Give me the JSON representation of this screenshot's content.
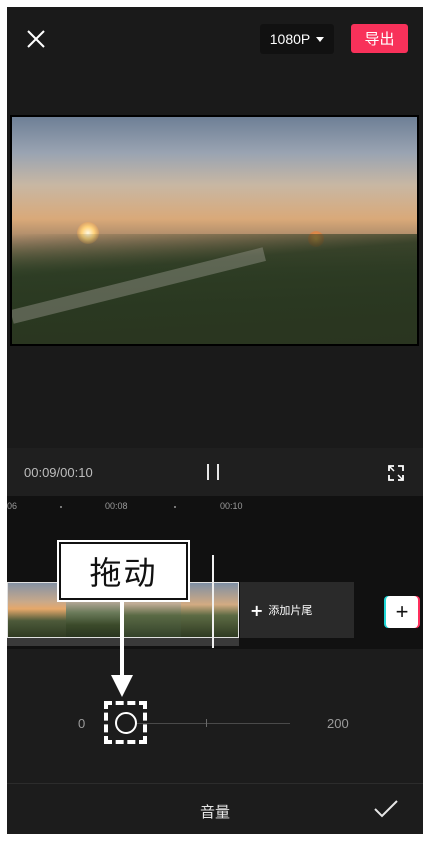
{
  "header": {
    "resolution_label": "1080P",
    "export_label": "导出"
  },
  "player": {
    "time_display": "00:09/00:10"
  },
  "ruler": {
    "labels": [
      "06",
      "00:08",
      "00:10"
    ]
  },
  "timeline": {
    "add_tail_label": "添加片尾"
  },
  "callout": {
    "text": "拖动"
  },
  "volume_slider": {
    "min_label": "0",
    "max_label": "200",
    "value": 0
  },
  "bottom": {
    "title": "音量"
  },
  "colors": {
    "export_button": "#f8315a",
    "background": "#1a1a1a"
  },
  "icons": {
    "close": "close-icon",
    "dropdown": "caret-down-icon",
    "pause": "pause-icon",
    "fullscreen": "fullscreen-icon",
    "add": "plus-icon",
    "confirm": "checkmark-icon"
  }
}
